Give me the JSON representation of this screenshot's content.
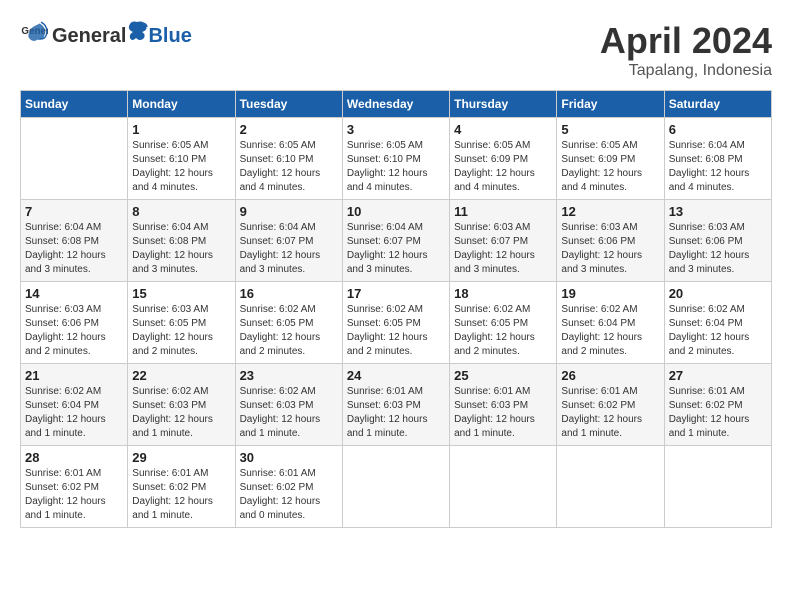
{
  "header": {
    "logo_general": "General",
    "logo_blue": "Blue",
    "title": "April 2024",
    "location": "Tapalang, Indonesia"
  },
  "weekdays": [
    "Sunday",
    "Monday",
    "Tuesday",
    "Wednesday",
    "Thursday",
    "Friday",
    "Saturday"
  ],
  "weeks": [
    [
      {
        "day": "",
        "info": ""
      },
      {
        "day": "1",
        "info": "Sunrise: 6:05 AM\nSunset: 6:10 PM\nDaylight: 12 hours\nand 4 minutes."
      },
      {
        "day": "2",
        "info": "Sunrise: 6:05 AM\nSunset: 6:10 PM\nDaylight: 12 hours\nand 4 minutes."
      },
      {
        "day": "3",
        "info": "Sunrise: 6:05 AM\nSunset: 6:10 PM\nDaylight: 12 hours\nand 4 minutes."
      },
      {
        "day": "4",
        "info": "Sunrise: 6:05 AM\nSunset: 6:09 PM\nDaylight: 12 hours\nand 4 minutes."
      },
      {
        "day": "5",
        "info": "Sunrise: 6:05 AM\nSunset: 6:09 PM\nDaylight: 12 hours\nand 4 minutes."
      },
      {
        "day": "6",
        "info": "Sunrise: 6:04 AM\nSunset: 6:08 PM\nDaylight: 12 hours\nand 4 minutes."
      }
    ],
    [
      {
        "day": "7",
        "info": "Sunrise: 6:04 AM\nSunset: 6:08 PM\nDaylight: 12 hours\nand 3 minutes."
      },
      {
        "day": "8",
        "info": "Sunrise: 6:04 AM\nSunset: 6:08 PM\nDaylight: 12 hours\nand 3 minutes."
      },
      {
        "day": "9",
        "info": "Sunrise: 6:04 AM\nSunset: 6:07 PM\nDaylight: 12 hours\nand 3 minutes."
      },
      {
        "day": "10",
        "info": "Sunrise: 6:04 AM\nSunset: 6:07 PM\nDaylight: 12 hours\nand 3 minutes."
      },
      {
        "day": "11",
        "info": "Sunrise: 6:03 AM\nSunset: 6:07 PM\nDaylight: 12 hours\nand 3 minutes."
      },
      {
        "day": "12",
        "info": "Sunrise: 6:03 AM\nSunset: 6:06 PM\nDaylight: 12 hours\nand 3 minutes."
      },
      {
        "day": "13",
        "info": "Sunrise: 6:03 AM\nSunset: 6:06 PM\nDaylight: 12 hours\nand 3 minutes."
      }
    ],
    [
      {
        "day": "14",
        "info": "Sunrise: 6:03 AM\nSunset: 6:06 PM\nDaylight: 12 hours\nand 2 minutes."
      },
      {
        "day": "15",
        "info": "Sunrise: 6:03 AM\nSunset: 6:05 PM\nDaylight: 12 hours\nand 2 minutes."
      },
      {
        "day": "16",
        "info": "Sunrise: 6:02 AM\nSunset: 6:05 PM\nDaylight: 12 hours\nand 2 minutes."
      },
      {
        "day": "17",
        "info": "Sunrise: 6:02 AM\nSunset: 6:05 PM\nDaylight: 12 hours\nand 2 minutes."
      },
      {
        "day": "18",
        "info": "Sunrise: 6:02 AM\nSunset: 6:05 PM\nDaylight: 12 hours\nand 2 minutes."
      },
      {
        "day": "19",
        "info": "Sunrise: 6:02 AM\nSunset: 6:04 PM\nDaylight: 12 hours\nand 2 minutes."
      },
      {
        "day": "20",
        "info": "Sunrise: 6:02 AM\nSunset: 6:04 PM\nDaylight: 12 hours\nand 2 minutes."
      }
    ],
    [
      {
        "day": "21",
        "info": "Sunrise: 6:02 AM\nSunset: 6:04 PM\nDaylight: 12 hours\nand 1 minute."
      },
      {
        "day": "22",
        "info": "Sunrise: 6:02 AM\nSunset: 6:03 PM\nDaylight: 12 hours\nand 1 minute."
      },
      {
        "day": "23",
        "info": "Sunrise: 6:02 AM\nSunset: 6:03 PM\nDaylight: 12 hours\nand 1 minute."
      },
      {
        "day": "24",
        "info": "Sunrise: 6:01 AM\nSunset: 6:03 PM\nDaylight: 12 hours\nand 1 minute."
      },
      {
        "day": "25",
        "info": "Sunrise: 6:01 AM\nSunset: 6:03 PM\nDaylight: 12 hours\nand 1 minute."
      },
      {
        "day": "26",
        "info": "Sunrise: 6:01 AM\nSunset: 6:02 PM\nDaylight: 12 hours\nand 1 minute."
      },
      {
        "day": "27",
        "info": "Sunrise: 6:01 AM\nSunset: 6:02 PM\nDaylight: 12 hours\nand 1 minute."
      }
    ],
    [
      {
        "day": "28",
        "info": "Sunrise: 6:01 AM\nSunset: 6:02 PM\nDaylight: 12 hours\nand 1 minute."
      },
      {
        "day": "29",
        "info": "Sunrise: 6:01 AM\nSunset: 6:02 PM\nDaylight: 12 hours\nand 1 minute."
      },
      {
        "day": "30",
        "info": "Sunrise: 6:01 AM\nSunset: 6:02 PM\nDaylight: 12 hours\nand 0 minutes."
      },
      {
        "day": "",
        "info": ""
      },
      {
        "day": "",
        "info": ""
      },
      {
        "day": "",
        "info": ""
      },
      {
        "day": "",
        "info": ""
      }
    ]
  ]
}
